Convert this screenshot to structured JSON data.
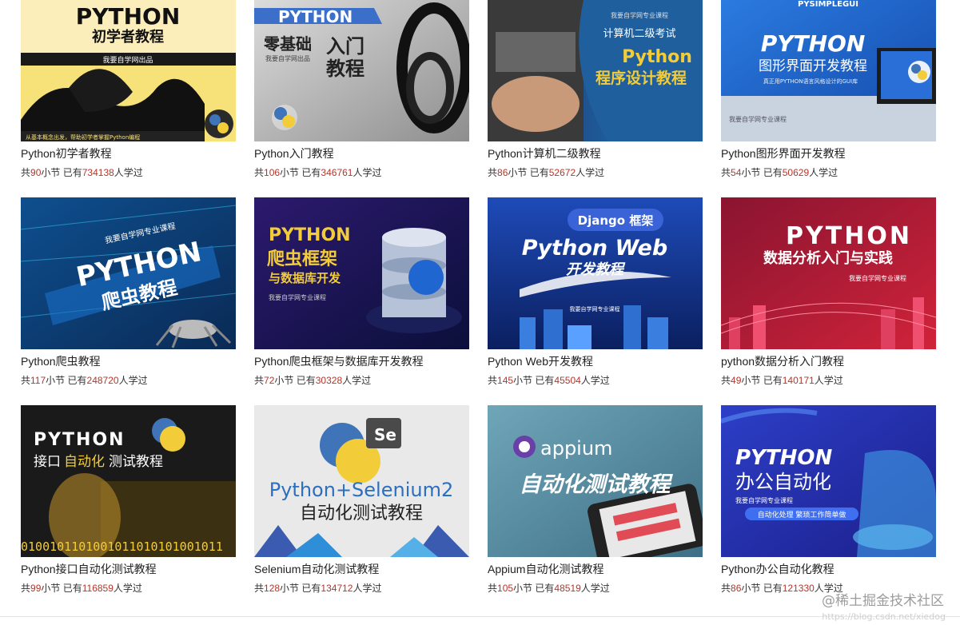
{
  "courses": [
    {
      "title": "Python初学者教程",
      "lessons": "90",
      "learners": "734138",
      "cover": {
        "line1": "PYTHON",
        "line2": "初学者教程",
        "line3": "我要自学网出品",
        "line4": "从基本概念出发，帮助初学者掌握Python编程"
      }
    },
    {
      "title": "Python入门教程",
      "lessons": "106",
      "learners": "346761",
      "cover": {
        "line1": "PYTHON",
        "line2": "零基础",
        "line3": "入门",
        "line4": "教程",
        "line5": "我要自学网出品"
      }
    },
    {
      "title": "Python计算机二级教程",
      "lessons": "86",
      "learners": "52672",
      "cover": {
        "line1": "我要自学网专业课程",
        "line2": "计算机二级考试",
        "line3": "Python",
        "line4": "程序设计教程"
      }
    },
    {
      "title": "Python图形界面开发教程",
      "lessons": "54",
      "learners": "50629",
      "cover": {
        "line1": "PYSIMPLEGUI",
        "line2": "PYTHON",
        "line3": "图形界面开发教程",
        "line4": "真正用PYTHON语言风格设计的GUI库",
        "line5": "我要自学网专业课程"
      }
    },
    {
      "title": "Python爬虫教程",
      "lessons": "117",
      "learners": "248720",
      "cover": {
        "line1": "我要自学网专业课程",
        "line2": "PYTHON",
        "line3": "爬虫教程"
      }
    },
    {
      "title": "Python爬虫框架与数据库开发教程",
      "lessons": "72",
      "learners": "30328",
      "cover": {
        "line1": "PYTHON",
        "line2": "爬虫框架",
        "line3": "与数据库开发",
        "line4": "我要自学网专业课程"
      }
    },
    {
      "title": "Python Web开发教程",
      "lessons": "145",
      "learners": "45504",
      "cover": {
        "line1": "Django 框架",
        "line2": "Python Web",
        "line3": "开发教程",
        "line4": "我要自学网专业课程"
      }
    },
    {
      "title": "python数据分析入门教程",
      "lessons": "49",
      "learners": "140171",
      "cover": {
        "line1": "PYTHON",
        "line2": "数据分析入门与实践",
        "line3": "我要自学网专业课程"
      }
    },
    {
      "title": "Python接口自动化测试教程",
      "lessons": "99",
      "learners": "116859",
      "cover": {
        "line1": "PYTHON",
        "line2": "接口",
        "line3": "自动化",
        "line4": "测试教程",
        "line5": "0100101101001011010101001011"
      }
    },
    {
      "title": "Selenium自动化测试教程",
      "lessons": "128",
      "learners": "134712",
      "cover": {
        "line1": "Python+Selenium2",
        "line2": "自动化测试教程",
        "line3": "Se"
      }
    },
    {
      "title": "Appium自动化测试教程",
      "lessons": "105",
      "learners": "48519",
      "cover": {
        "line1": "appium",
        "line2": "自动化测试教程"
      }
    },
    {
      "title": "Python办公自动化教程",
      "lessons": "86",
      "learners": "121330",
      "cover": {
        "line1": "PYTHON",
        "line2": "办公自动化",
        "line3": "我要自学网专业课程",
        "line4": "自动化处理  繁琐工作简单做"
      }
    }
  ],
  "labels": {
    "prefix": "共",
    "lessons_suffix": "小节",
    "learners_prefix": "已有",
    "learners_suffix": "人学过"
  },
  "watermark": {
    "text": "@稀土掘金技术社区",
    "url": "https://blog.csdn.net/xiedog"
  },
  "colors": {
    "count_highlight": "#b5352a",
    "title_text": "#222222"
  }
}
